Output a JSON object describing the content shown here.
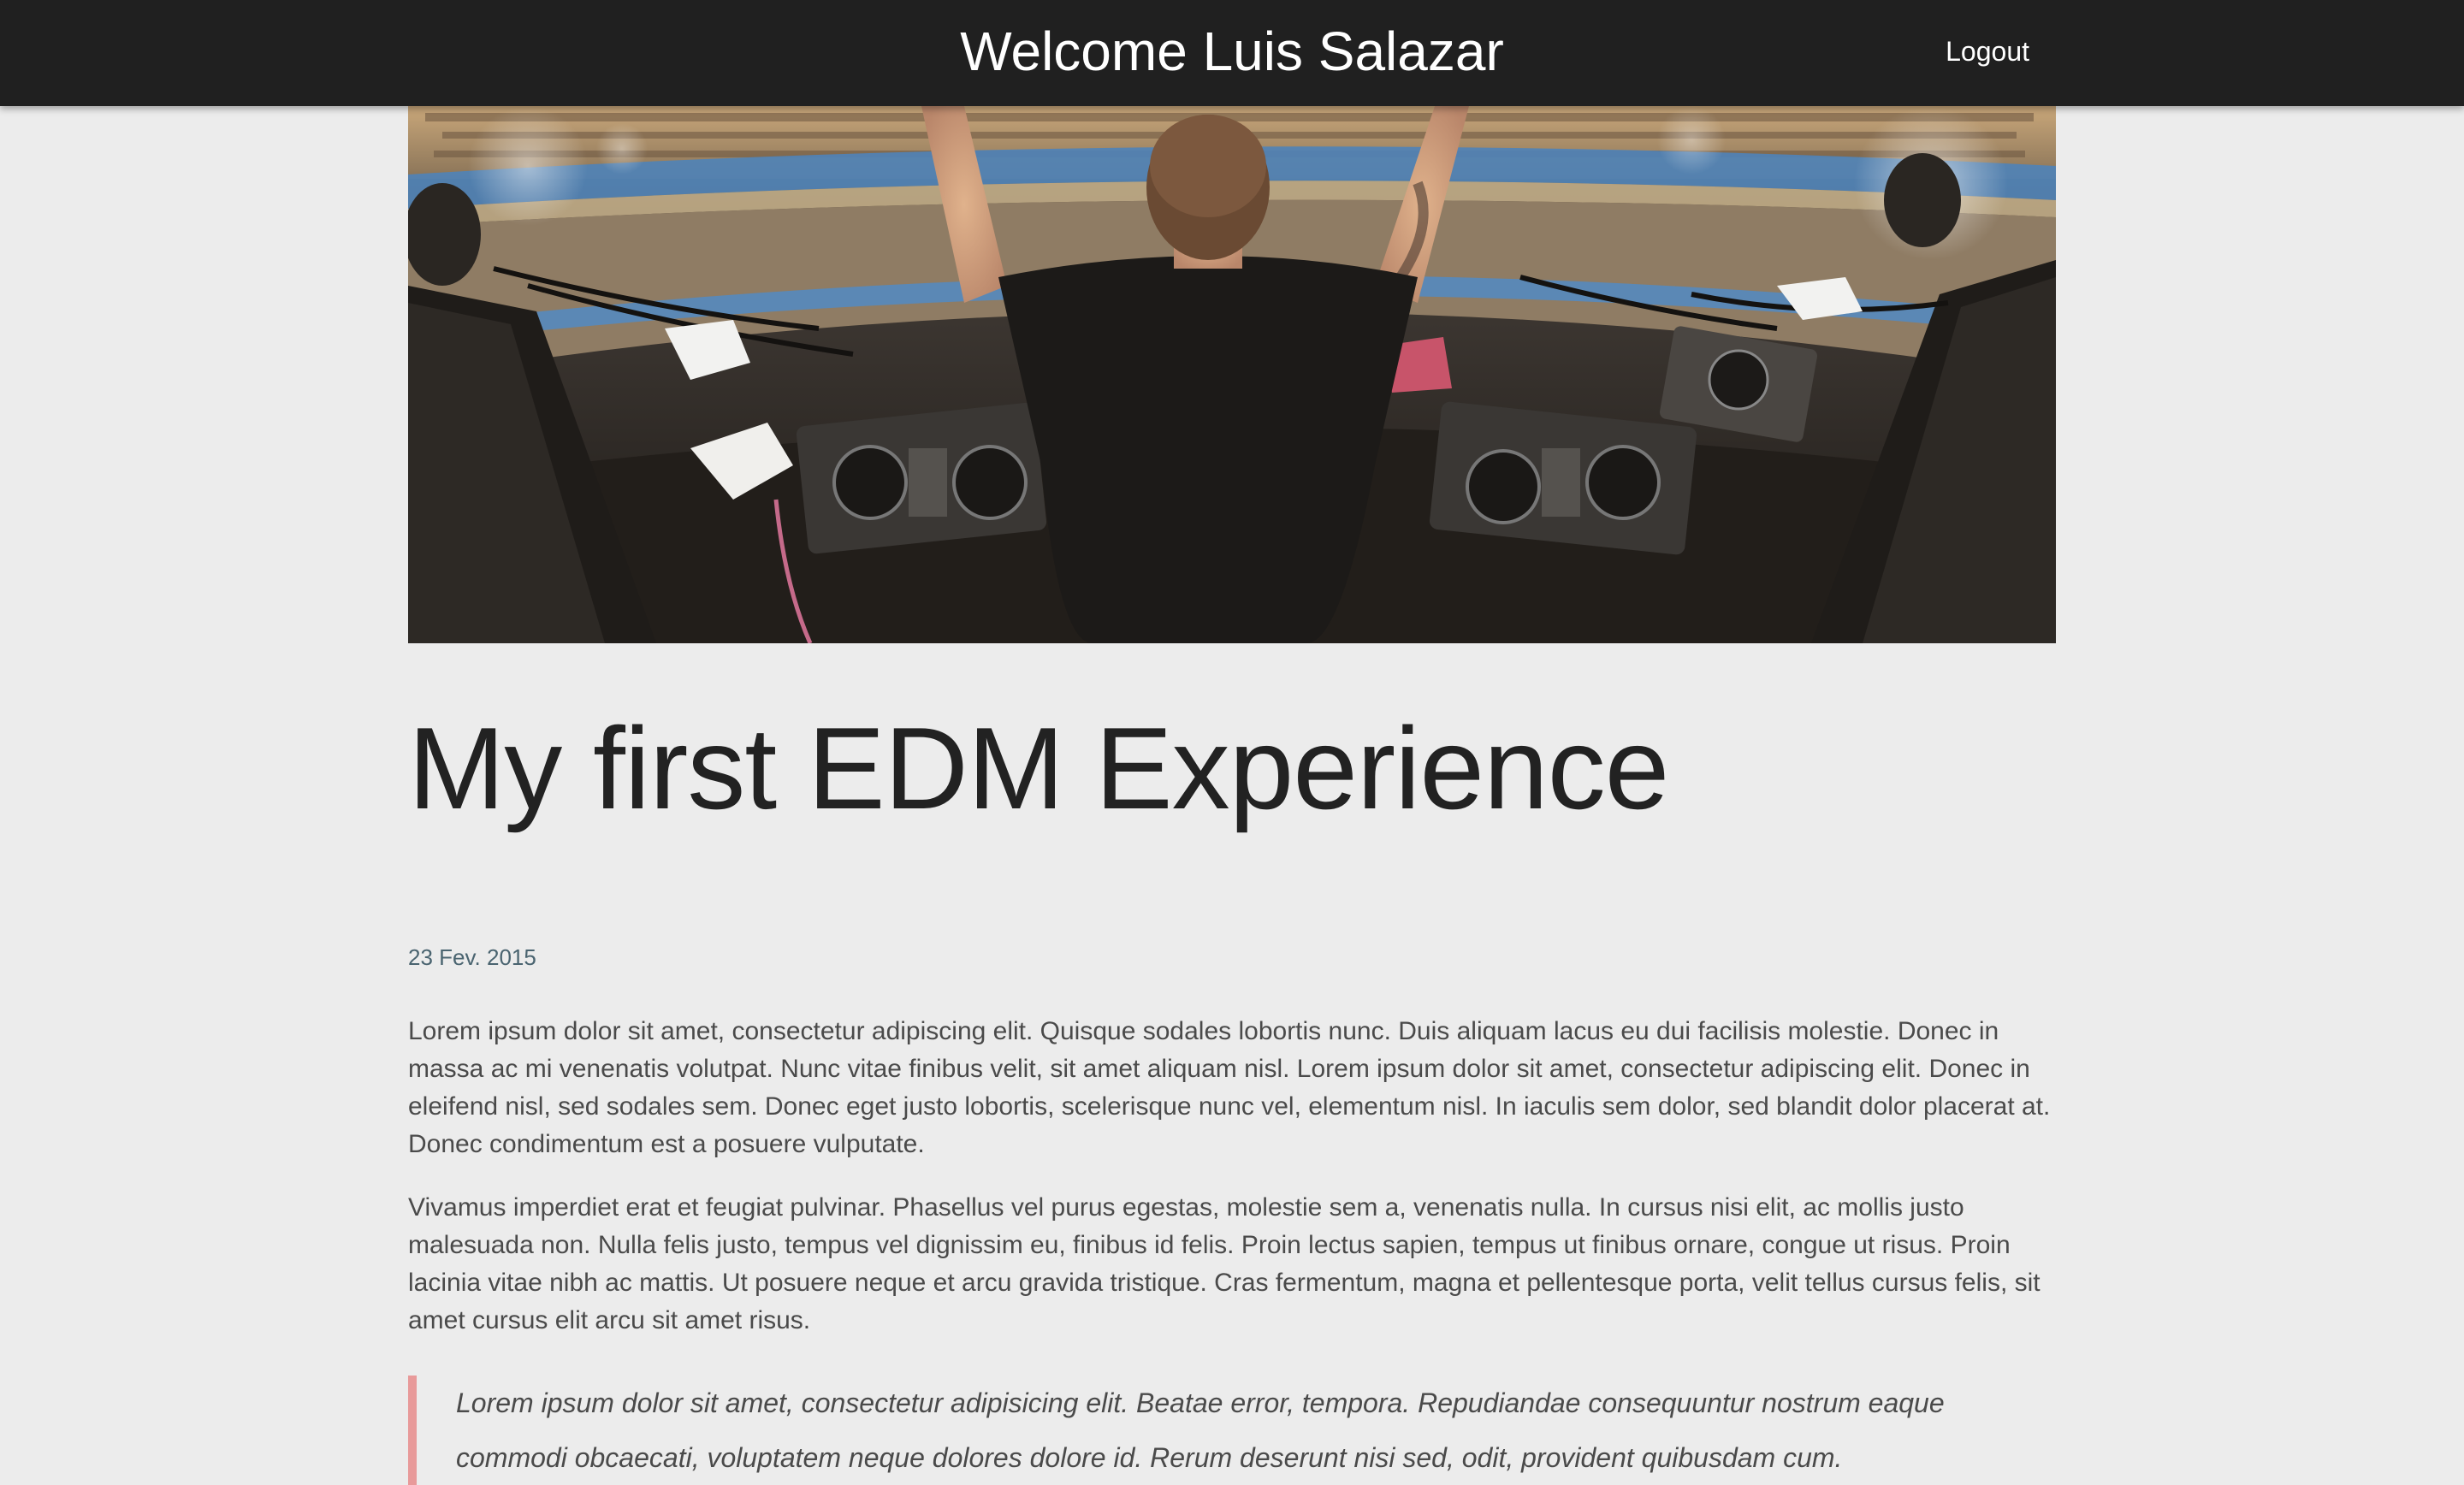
{
  "header": {
    "welcome": "Welcome Luis Salazar",
    "logout_label": "Logout"
  },
  "hero": {
    "alt": "DJ with raised arms performing on stage in front of a large festival crowd"
  },
  "post": {
    "title": "My first EDM Experience",
    "date": "23 Fev. 2015",
    "paragraphs": [
      "Lorem ipsum dolor sit amet, consectetur adipiscing elit. Quisque sodales lobortis nunc. Duis aliquam lacus eu dui facilisis molestie. Donec in massa ac mi venenatis volutpat. Nunc vitae finibus velit, sit amet aliquam nisl. Lorem ipsum dolor sit amet, consectetur adipiscing elit. Donec in eleifend nisl, sed sodales sem. Donec eget justo lobortis, scelerisque nunc vel, elementum nisl. In iaculis sem dolor, sed blandit dolor placerat at. Donec condimentum est a posuere vulputate.",
      "Vivamus imperdiet erat et feugiat pulvinar. Phasellus vel purus egestas, molestie sem a, venenatis nulla. In cursus nisi elit, ac mollis justo malesuada non. Nulla felis justo, tempus vel dignissim eu, finibus id felis. Proin lectus sapien, tempus ut finibus ornare, congue ut risus. Proin lacinia vitae nibh ac mattis. Ut posuere neque et arcu gravida tristique. Cras fermentum, magna et pellentesque porta, velit tellus cursus felis, sit amet cursus elit arcu sit amet risus."
    ],
    "quote": "Lorem ipsum dolor sit amet, consectetur adipisicing elit. Beatae error, tempora. Repudiandae consequuntur nostrum eaque commodi obcaecati, voluptatem neque dolores dolore id. Rerum deserunt nisi sed, odit, provident quibusdam cum."
  },
  "colors": {
    "topbar_bg": "#202020",
    "page_bg": "#ececec",
    "date_text": "#4a6470",
    "quote_border": "#e89a9a"
  }
}
